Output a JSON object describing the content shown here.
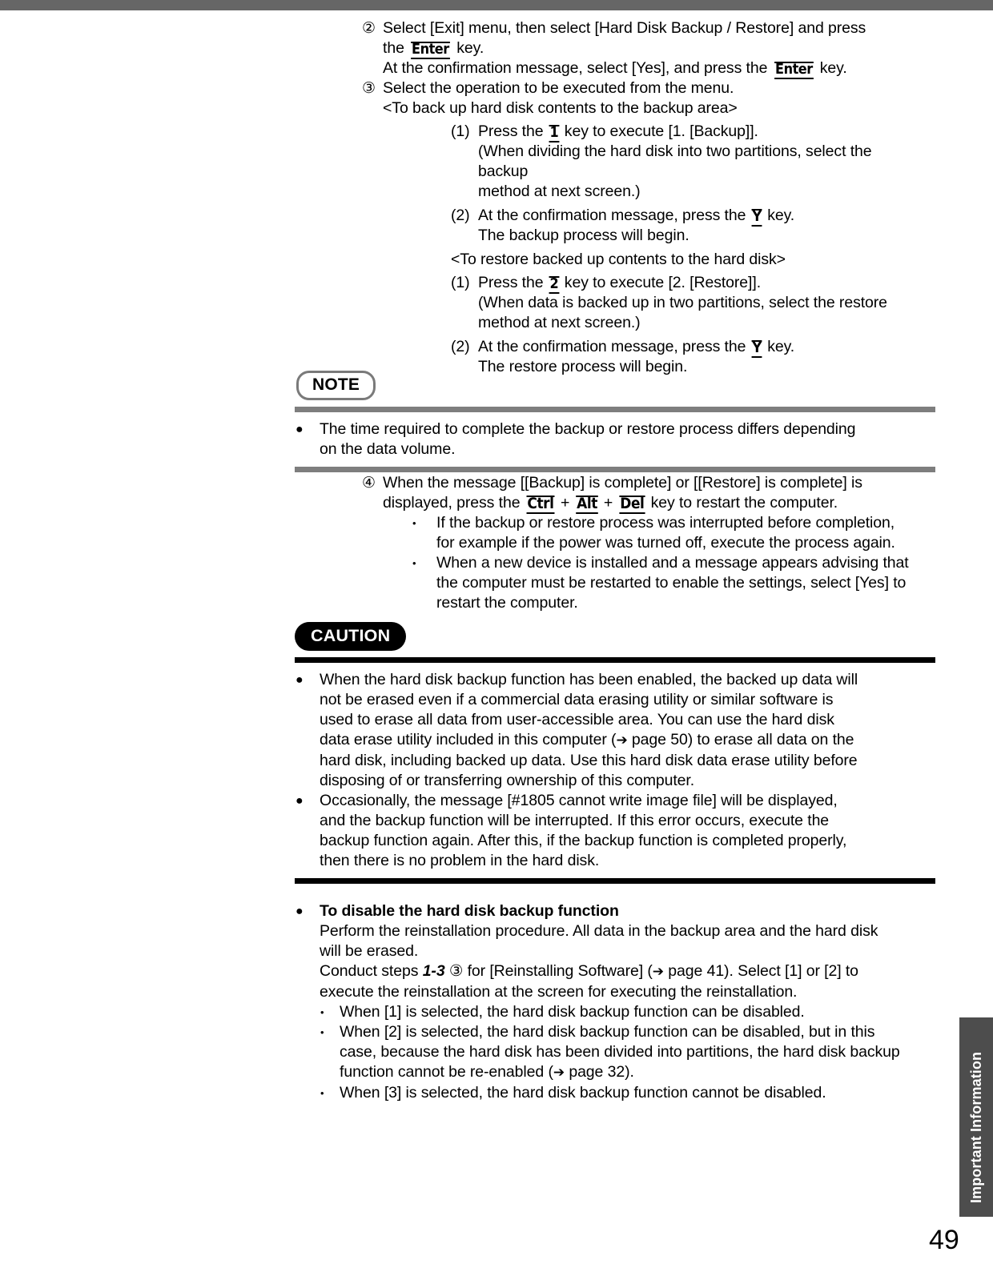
{
  "page": {
    "number": "49",
    "side_tab_label": "Important Information",
    "band_color": "#666666",
    "side_tab_color": "#4d4d4d",
    "note_rule_color": "#7e7e7e",
    "caution_rule_color": "#000000"
  },
  "steps": {
    "step2": {
      "marker": "②",
      "line1_a": "Select [Exit] menu, then select [Hard Disk Backup / Restore] and press",
      "line2_a": "the ",
      "line2_key": "Enter",
      "line2_b": " key.",
      "line3_a": "At the confirmation message, select [Yes], and press the ",
      "line3_key": "Enter",
      "line3_b": " key."
    },
    "step3": {
      "marker": "③",
      "line1": "Select the operation to be executed from the menu.",
      "angle1": "<To back up hard disk contents to the backup area>",
      "backup": {
        "item1_num": "(1)",
        "item1_a": "Press the ",
        "item1_key": "1",
        "item1_b": " key to execute [1. [Backup]].",
        "item1_l2": "(When dividing the hard disk into two partitions, select the backup",
        "item1_l3": "method at next screen.)",
        "item2_num": "(2)",
        "item2_a": "At the confirmation message, press the ",
        "item2_key": "Y",
        "item2_b": " key.",
        "item2_l2": "The backup process will begin."
      },
      "angle2": "<To restore backed up contents to the hard disk>",
      "restore": {
        "item1_num": "(1)",
        "item1_a": "Press the ",
        "item1_key": "2",
        "item1_b": " key to execute [2. [Restore]].",
        "item1_l2": "(When data is backed up in two partitions, select the restore",
        "item1_l3": "method at next screen.)",
        "item2_num": "(2)",
        "item2_a": "At the confirmation message, press the ",
        "item2_key": "Y",
        "item2_b": " key.",
        "item2_l2": "The restore process will begin."
      }
    },
    "step4": {
      "marker": "④",
      "line1": "When the message [[Backup] is complete] or [[Restore] is complete] is",
      "line2_a": "displayed, press the ",
      "key_ctrl": "Ctrl",
      "plus1": " + ",
      "key_alt": "Alt",
      "plus2": " + ",
      "key_del": "Del",
      "line2_b": " key to restart the computer.",
      "bullets": [
        {
          "marker": "•",
          "lines": [
            "If the backup or restore process was interrupted before completion,",
            "for example if the power was turned off, execute the process again."
          ]
        },
        {
          "marker": "•",
          "lines": [
            "When a new device is installed and a message appears advising that",
            "the computer must be restarted to enable the settings, select [Yes] to",
            "restart the computer."
          ]
        }
      ]
    }
  },
  "note_box": {
    "badge": "NOTE",
    "bullets": [
      {
        "marker": "●",
        "lines": [
          "The time required to complete the backup or restore process differs depending",
          "on the data volume."
        ]
      }
    ]
  },
  "caution_box": {
    "badge": "CAUTION",
    "bullets": [
      {
        "marker": "●",
        "line1": "When the hard disk backup function has been enabled, the backed up data will",
        "line2": "not be erased even if a commercial data erasing utility or similar software is",
        "line3": "used to erase all data from user-accessible area. You can use the hard disk",
        "line4_a": "data erase utility included in this computer (",
        "line4_arrow": "➔",
        "line4_b": " page 50) to erase all data on the",
        "line5": "hard disk, including backed up data. Use this hard disk data erase utility before",
        "line6": "disposing of or transferring ownership of this computer."
      },
      {
        "marker": "●",
        "line1": "Occasionally, the message [#1805 cannot write image file] will be displayed,",
        "line2": "and the backup function will be interrupted.  If this error occurs, execute the",
        "line3": "backup function again.  After this, if the backup function is completed properly,",
        "line4": "then there is no problem in the hard disk."
      }
    ]
  },
  "disable_section": {
    "marker": "●",
    "heading": "To disable the hard disk backup function",
    "line1": "Perform the reinstallation procedure. All data in the backup area and the hard disk",
    "line2": "will be erased.",
    "line3_a": "Conduct steps ",
    "line3_bold": "1-3",
    "line3_b": " ③ for [Reinstalling Software]  (",
    "line3_arrow": "➔",
    "line3_c": " page 41). Select [1] or [2] to",
    "line4": "execute the reinstallation at the screen for executing the reinstallation.",
    "bullets": [
      {
        "marker": "•",
        "lines": [
          "When [1] is selected, the hard disk backup function can be disabled."
        ]
      },
      {
        "marker": "•",
        "line1": "When [2] is selected, the hard disk backup function can be disabled, but in this",
        "line2": "case, because the hard disk has been divided into partitions, the hard disk backup",
        "line3_a": "function cannot be re-enabled (",
        "line3_arrow": "➔",
        "line3_b": " page 32)."
      },
      {
        "marker": "•",
        "lines": [
          "When [3] is selected, the hard disk backup function cannot be disabled."
        ]
      }
    ]
  }
}
